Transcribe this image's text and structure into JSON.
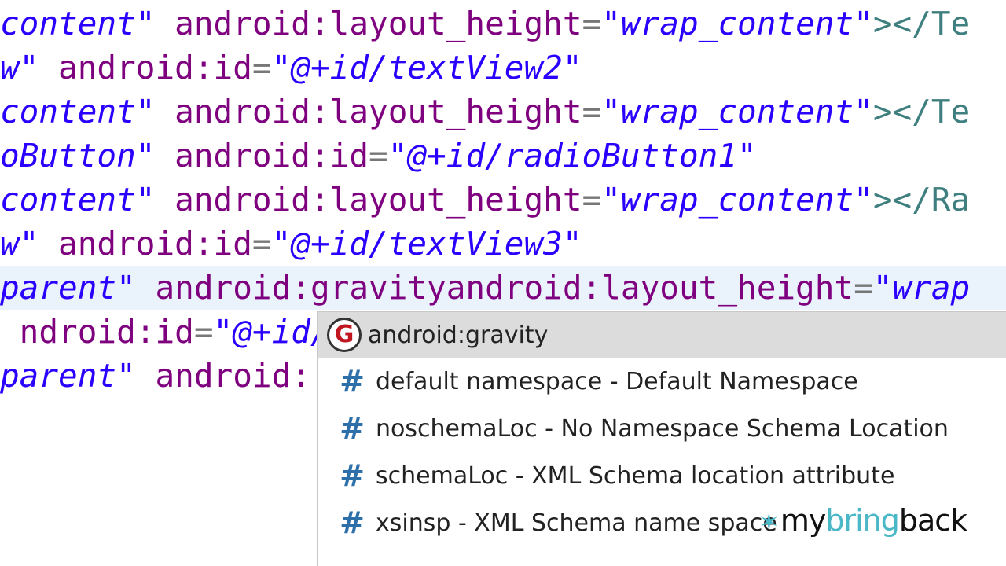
{
  "editor": {
    "lines": [
      [
        {
          "c": "a",
          "t": ""
        },
        {
          "c": "v",
          "t": "content\""
        },
        {
          "c": "a",
          "t": " android:layout_height"
        },
        {
          "c": "e",
          "t": "="
        },
        {
          "c": "v",
          "t": "\"wrap_content\""
        },
        {
          "c": "t",
          "t": "></Te"
        }
      ],
      [
        {
          "c": "v",
          "t": "w\""
        },
        {
          "c": "a",
          "t": " android:id"
        },
        {
          "c": "e",
          "t": "="
        },
        {
          "c": "v",
          "t": "\"@+id/textView2\""
        }
      ],
      [
        {
          "c": "v",
          "t": "content\""
        },
        {
          "c": "a",
          "t": " android:layout_height"
        },
        {
          "c": "e",
          "t": "="
        },
        {
          "c": "v",
          "t": "\"wrap_content\""
        },
        {
          "c": "t",
          "t": "></Te"
        }
      ],
      [
        {
          "c": "v",
          "t": "oButton\""
        },
        {
          "c": "a",
          "t": " android:id"
        },
        {
          "c": "e",
          "t": "="
        },
        {
          "c": "v",
          "t": "\"@+id/radioButton1\""
        }
      ],
      [
        {
          "c": "v",
          "t": "content\""
        },
        {
          "c": "a",
          "t": " android:layout_height"
        },
        {
          "c": "e",
          "t": "="
        },
        {
          "c": "v",
          "t": "\"wrap_content\""
        },
        {
          "c": "t",
          "t": "></Ra"
        }
      ],
      [
        {
          "c": "v",
          "t": "w\""
        },
        {
          "c": "a",
          "t": " android:id"
        },
        {
          "c": "e",
          "t": "="
        },
        {
          "c": "v",
          "t": "\"@+id/textView3\""
        }
      ],
      [
        {
          "c": "v",
          "t": "parent\""
        },
        {
          "c": "a",
          "t": " android:gravityandroid:layout_height"
        },
        {
          "c": "e",
          "t": "="
        },
        {
          "c": "v",
          "t": "\"wrap"
        }
      ],
      [
        {
          "c": "a",
          "t": " ndroid:id"
        },
        {
          "c": "e",
          "t": "="
        },
        {
          "c": "v",
          "t": "\"@+id/"
        }
      ],
      [
        {
          "c": "v",
          "t": "parent\""
        },
        {
          "c": "a",
          "t": " android:"
        }
      ]
    ]
  },
  "autocomplete": {
    "items": [
      {
        "icon": "G",
        "label": "android:gravity"
      },
      {
        "icon": "#",
        "label": "default namespace - Default Namespace"
      },
      {
        "icon": "#",
        "label": "noschemaLoc - No Namespace Schema Location"
      },
      {
        "icon": "#",
        "label": "schemaLoc - XML Schema location attribute"
      },
      {
        "icon": "#",
        "label": "xsinsp - XML Schema name space"
      }
    ]
  },
  "watermark": {
    "my": "my",
    "bring": "bring",
    "back": "back"
  }
}
